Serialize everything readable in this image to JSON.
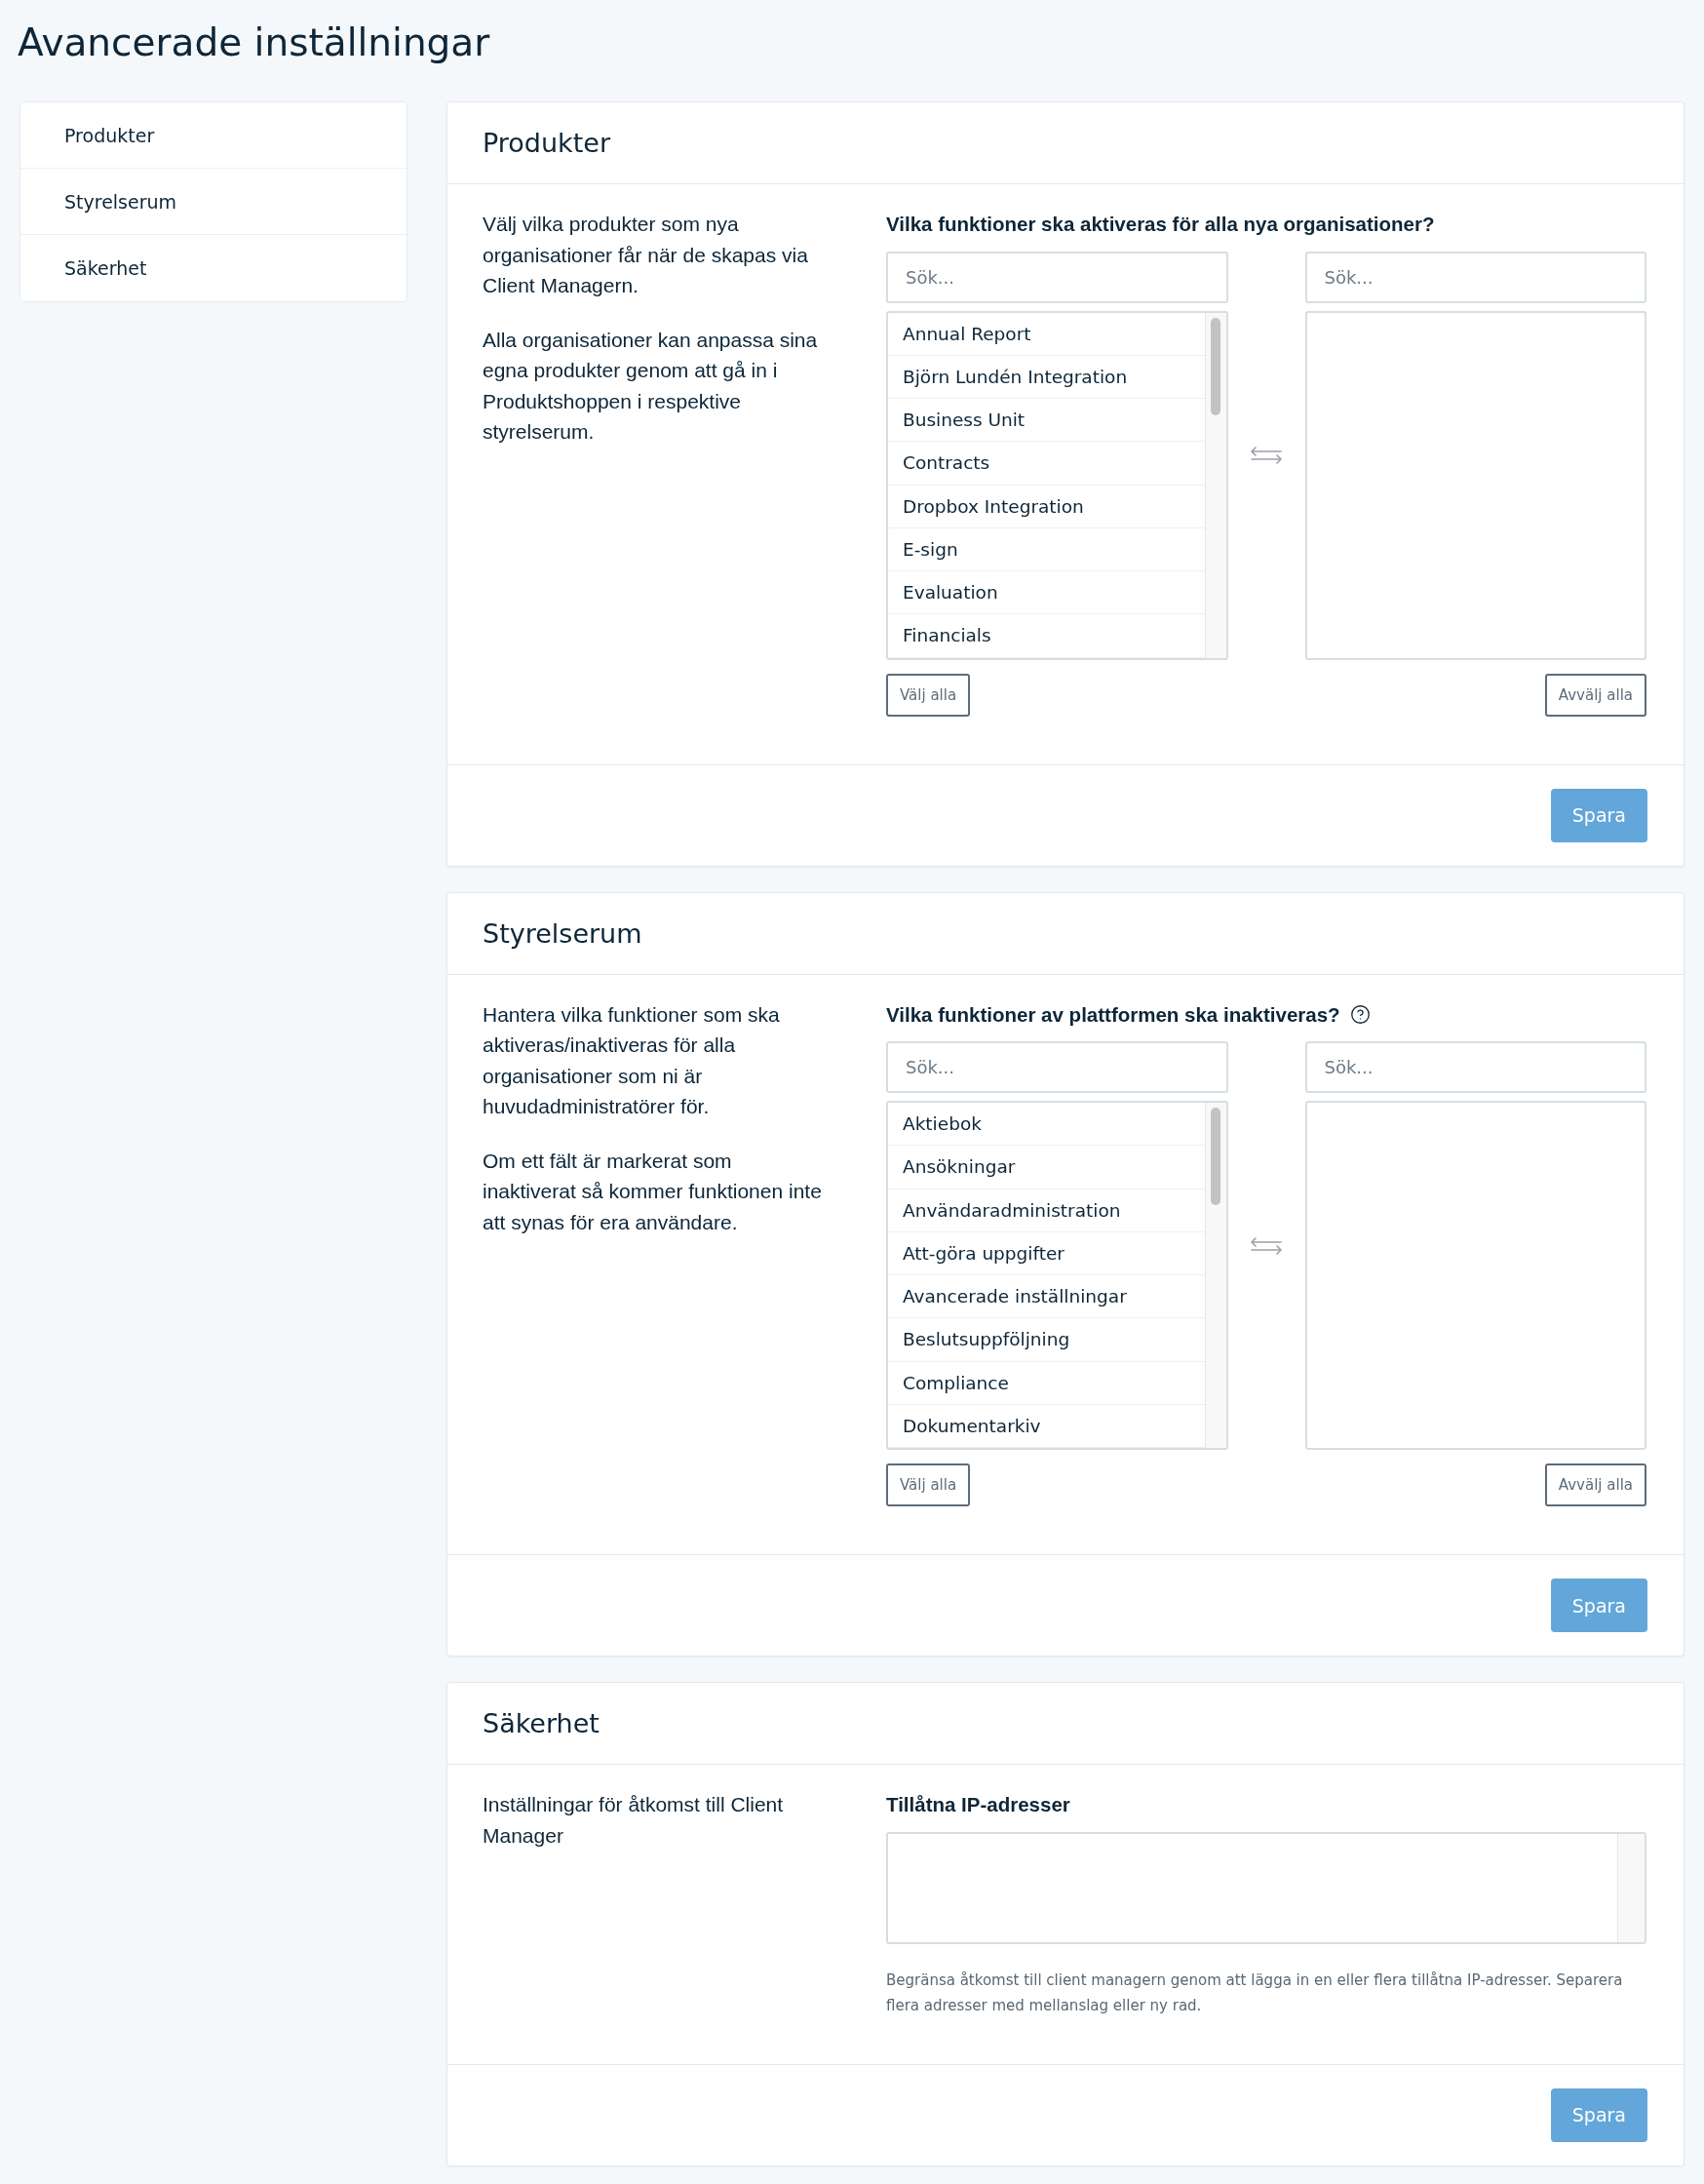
{
  "page_title": "Avancerade inställningar",
  "sidebar": {
    "items": [
      {
        "label": "Produkter",
        "selected": false
      },
      {
        "label": "Styrelserum",
        "selected": false
      },
      {
        "label": "Säkerhet",
        "selected": false
      }
    ]
  },
  "sections": [
    {
      "kind": "dual_list",
      "title": "Produkter",
      "description": [
        "Välj vilka produkter som nya organisationer får när de skapas via Client Managern.",
        "Alla organisationer kan anpassa sina egna produkter genom att gå in i Produktshoppen i respektive styrelserum."
      ],
      "label": "Vilka funktioner ska aktiveras för alla nya organisationer?",
      "available": {
        "placeholder": "Sök...",
        "items": [
          {
            "label": "Annual Report",
            "selected": false
          },
          {
            "label": "Björn Lundén Integration",
            "selected": false
          },
          {
            "label": "Business Unit",
            "selected": false
          },
          {
            "label": "Contracts",
            "selected": false
          },
          {
            "label": "Dropbox Integration",
            "selected": false
          },
          {
            "label": "E-sign",
            "selected": false
          },
          {
            "label": "Evaluation",
            "selected": false
          },
          {
            "label": "Financials",
            "selected": false
          }
        ],
        "button": "Välj alla"
      },
      "chosen": {
        "placeholder": "Sök...",
        "button": "Avvälj alla"
      },
      "save_button": "Spara"
    },
    {
      "kind": "dual_list",
      "title": "Styrelserum",
      "description": [
        "Hantera vilka funktioner som ska aktiveras/inaktiveras för alla organisationer som ni är huvudadministratörer för.",
        "Om ett fält är markerat som inaktiverat så kommer funktionen inte att synas för era användare."
      ],
      "label": "Vilka funktioner av plattformen ska inaktiveras?",
      "help_icon": true,
      "available": {
        "placeholder": "Sök...",
        "items": [
          {
            "label": "Aktiebok",
            "selected": false
          },
          {
            "label": "Ansökningar",
            "selected": false
          },
          {
            "label": "Användaradministration",
            "selected": false
          },
          {
            "label": "Att-göra uppgifter",
            "selected": false
          },
          {
            "label": "Avancerade inställningar",
            "selected": false
          },
          {
            "label": "Beslutsuppföljning",
            "selected": false
          },
          {
            "label": "Compliance",
            "selected": false
          },
          {
            "label": "Dokumentarkiv",
            "selected": false
          }
        ],
        "button": "Välj alla"
      },
      "chosen": {
        "placeholder": "Sök...",
        "button": "Avvälj alla"
      },
      "save_button": "Spara"
    },
    {
      "kind": "ip_field",
      "title": "Säkerhet",
      "description": [
        "Inställningar för åtkomst till Client Manager"
      ],
      "label": "Tillåtna IP-adresser",
      "help_text": "Begränsa åtkomst till client managern genom att lägga in en eller flera tillåtna IP-adresser. Separera flera adresser med mellanslag eller ny rad.",
      "save_button": "Spara"
    }
  ]
}
